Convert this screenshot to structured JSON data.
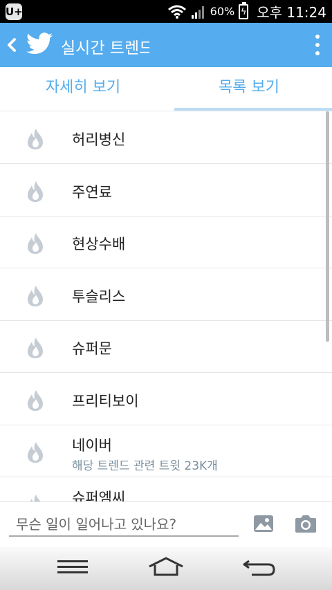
{
  "status": {
    "carrier_badge": "U+",
    "battery_percent": "60%",
    "time": "오후 11:24"
  },
  "appbar": {
    "title": "실시간 트렌드"
  },
  "tabs": [
    {
      "label": "자세히 보기"
    },
    {
      "label": "목록 보기"
    }
  ],
  "trends": [
    {
      "name": "허리병신"
    },
    {
      "name": "주연료"
    },
    {
      "name": "현상수배"
    },
    {
      "name": "투슬리스"
    },
    {
      "name": "슈퍼문"
    },
    {
      "name": "프리티보이"
    },
    {
      "name": "네이버",
      "sub": "해당 트렌드 관련 트윗 23K개"
    },
    {
      "name": "슈퍼엠씨"
    }
  ],
  "composer": {
    "placeholder": "무슨 일이 일어나고 있나요?"
  },
  "colors": {
    "accent": "#55acee",
    "flame": "#c5ccd3"
  }
}
